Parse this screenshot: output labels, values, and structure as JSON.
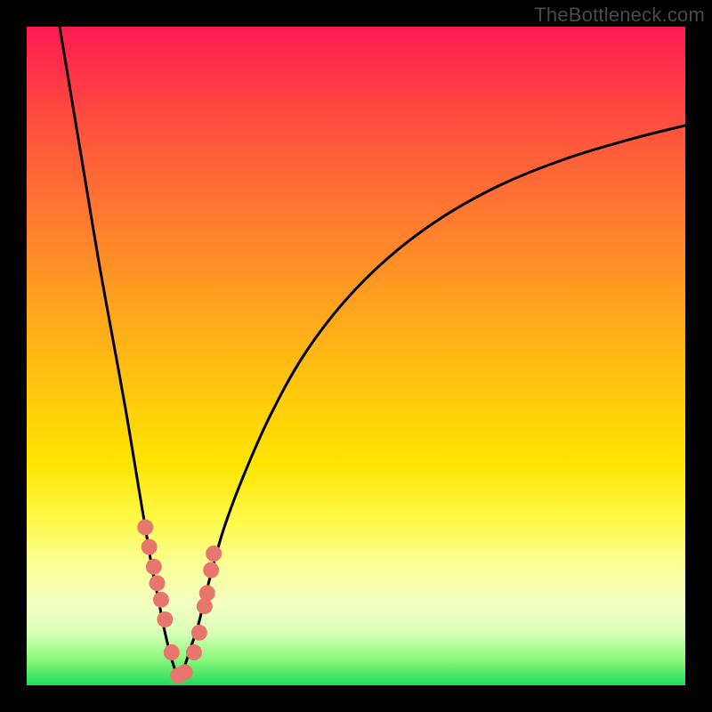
{
  "watermark": "TheBottleneck.com",
  "colors": {
    "frame": "#000000",
    "curve": "#000000",
    "marker": "#e9766c",
    "gradient_top": "#ff1a53",
    "gradient_bottom": "#1fdc5f"
  },
  "chart_data": {
    "type": "line",
    "title": "",
    "xlabel": "",
    "ylabel": "",
    "xlim": [
      0,
      100
    ],
    "ylim": [
      0,
      100
    ],
    "grid": false,
    "legend": false,
    "note": "Values estimated from pixel positions; y is bottleneck % (0 at bottom/green, 100 at top/red). Curve minimum ~x=23.",
    "series": [
      {
        "name": "left-branch",
        "x": [
          5,
          7,
          9,
          11,
          13,
          15,
          17,
          18,
          19,
          20,
          21,
          22,
          23
        ],
        "y": [
          100,
          88,
          76,
          64,
          53,
          42,
          30,
          24,
          18,
          13,
          8,
          4,
          1
        ]
      },
      {
        "name": "right-branch",
        "x": [
          23,
          24,
          25,
          26,
          27,
          28,
          30,
          33,
          37,
          42,
          48,
          55,
          63,
          72,
          82,
          92,
          100
        ],
        "y": [
          1,
          3,
          6,
          9,
          13,
          17,
          24,
          32,
          41,
          50,
          58,
          65,
          71,
          76,
          80,
          83,
          85
        ]
      }
    ],
    "markers": {
      "name": "highlighted-points",
      "note": "Pink dot markers clustered near the valley of the V.",
      "x": [
        18.0,
        18.6,
        19.3,
        19.8,
        20.4,
        21.0,
        22.0,
        23.0,
        24.0,
        25.4,
        26.2,
        27.0,
        27.4,
        28.0,
        28.4
      ],
      "y": [
        24.0,
        21.0,
        18.0,
        15.5,
        13.0,
        10.0,
        5.0,
        1.5,
        2.0,
        5.0,
        8.0,
        12.0,
        14.0,
        17.5,
        20.0
      ]
    }
  }
}
